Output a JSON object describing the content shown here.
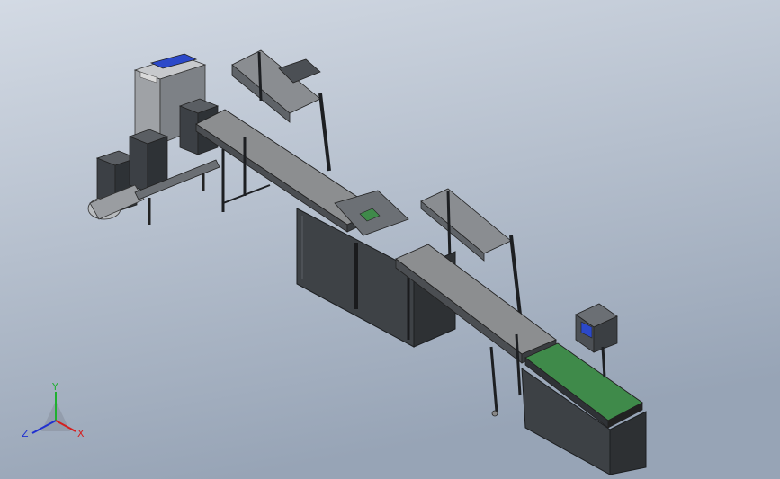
{
  "viewport": {
    "background_top": "#cdd5e0",
    "background_bottom": "#9aa7b8"
  },
  "model": {
    "icon": "cad-assembly",
    "frame_color": "#2f3236",
    "panel_color": "#4a4e53",
    "belt_gray": "#8a8c8e",
    "belt_green": "#3f8a4a",
    "screen_color": "#2a46c8"
  },
  "triad": {
    "x_label": "X",
    "y_label": "Y",
    "z_label": "Z",
    "x_color": "#d42020",
    "y_color": "#20b030",
    "z_color": "#2030d0"
  }
}
